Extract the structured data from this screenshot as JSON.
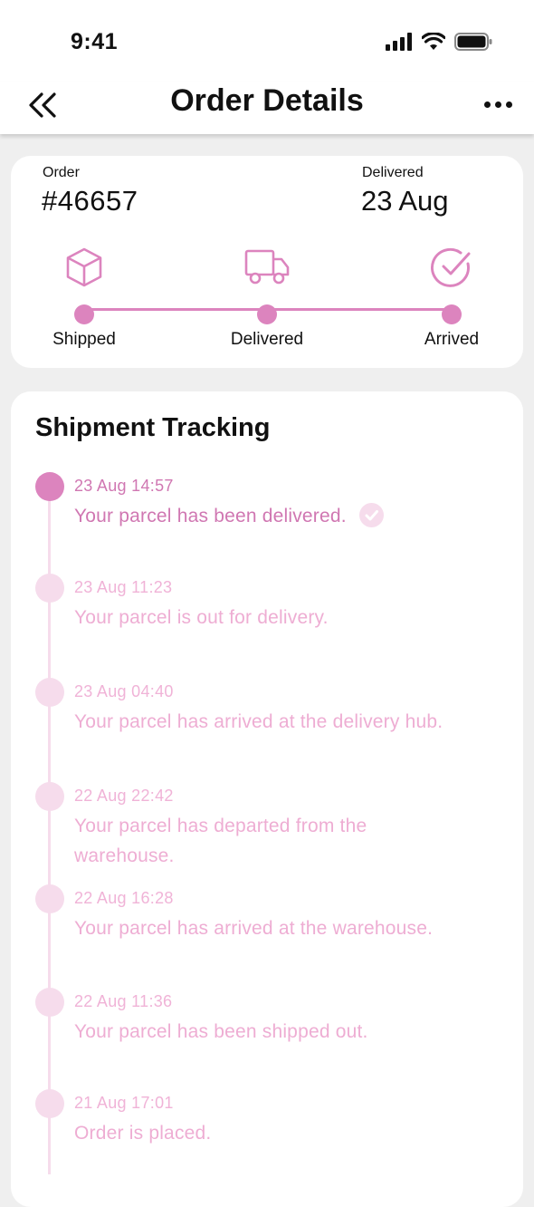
{
  "status_bar": {
    "time": "9:41"
  },
  "header": {
    "title": "Order Details"
  },
  "order": {
    "order_label": "Order",
    "order_number": "#46657",
    "delivered_label": "Delivered",
    "delivered_date": "23 Aug",
    "steps": [
      {
        "label": "Shipped",
        "icon": "box-icon"
      },
      {
        "label": "Delivered",
        "icon": "truck-icon"
      },
      {
        "label": "Arrived",
        "icon": "check-circle-icon"
      }
    ]
  },
  "tracking": {
    "title": "Shipment Tracking",
    "events": [
      {
        "time": "23 Aug 14:57",
        "text": "Your parcel has been delivered."
      },
      {
        "time": "23 Aug 11:23",
        "text": "Your parcel is out for delivery."
      },
      {
        "time": "23 Aug 04:40",
        "text": "Your parcel has arrived at the delivery hub."
      },
      {
        "time": "22 Aug 22:42",
        "text": "Your parcel has departed from the warehouse."
      },
      {
        "time": "22 Aug 16:28",
        "text": "Your parcel has arrived at the warehouse."
      },
      {
        "time": "22 Aug 11:36",
        "text": "Your parcel has been shipped out."
      },
      {
        "time": "21 Aug 17:01",
        "text": "Order is placed."
      }
    ]
  },
  "colors": {
    "accent": "#dc84be",
    "accent_light": "#f6dcec",
    "muted_text": "#eeadd3"
  }
}
